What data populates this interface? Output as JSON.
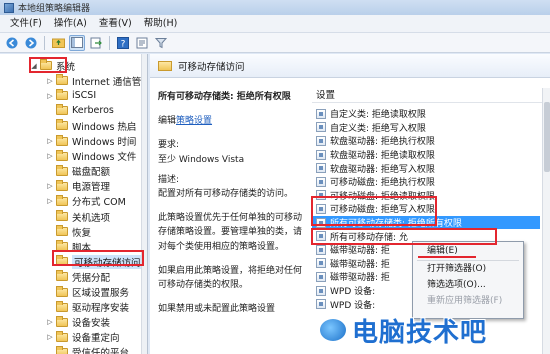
{
  "window": {
    "title": "本地组策略编辑器"
  },
  "menu": [
    "文件(F)",
    "操作(A)",
    "查看(V)",
    "帮助(H)"
  ],
  "toolbar": [
    "back-icon",
    "forward-icon",
    "folder-up-icon",
    "show-hide-tree-icon",
    "export-icon",
    "help-icon",
    "properties-icon",
    "filter-icon"
  ],
  "tree": {
    "items": [
      {
        "label": "系统",
        "expander": "◢",
        "selected": false
      },
      {
        "label": "Internet 通信管",
        "expander": "▷"
      },
      {
        "label": "iSCSI",
        "expander": "▷"
      },
      {
        "label": "Kerberos",
        "expander": ""
      },
      {
        "label": "Windows 热启",
        "expander": ""
      },
      {
        "label": "Windows 时间",
        "expander": "▷"
      },
      {
        "label": "Windows 文件",
        "expander": "▷"
      },
      {
        "label": "磁盘配额",
        "expander": ""
      },
      {
        "label": "电源管理",
        "expander": "▷"
      },
      {
        "label": "分布式 COM",
        "expander": "▷"
      },
      {
        "label": "关机选项",
        "expander": ""
      },
      {
        "label": "恢复",
        "expander": ""
      },
      {
        "label": "脚本",
        "expander": ""
      },
      {
        "label": "可移动存储访问",
        "expander": "",
        "selected": true
      },
      {
        "label": "凭据分配",
        "expander": ""
      },
      {
        "label": "区域设置服务",
        "expander": ""
      },
      {
        "label": "驱动程序安装",
        "expander": ""
      },
      {
        "label": "设备安装",
        "expander": "▷"
      },
      {
        "label": "设备重定向",
        "expander": "▷"
      },
      {
        "label": "受信任的平台",
        "expander": ""
      }
    ]
  },
  "pane": {
    "header": "可移动存储访问",
    "setting_title": "所有可移动存储类: 拒绝所有权限",
    "edit_prefix": "编辑",
    "edit_link": "策略设置",
    "req_label": "要求:",
    "req_value": "至少 Windows Vista",
    "desc_label": "描述:",
    "desc_value": "配置对所有可移动存储类的访问。",
    "para1": "此策略设置优先于任何单独的可移动存储策略设置。要管理单独的类，请对每个类使用相应的策略设置。",
    "para2": "如果启用此策略设置，将拒绝对任何可移动存储类的权限。",
    "para3": "如果禁用或未配置此策略设置"
  },
  "list": {
    "column": "设置",
    "rows": [
      "自定义类: 拒绝读取权限",
      "自定义类: 拒绝写入权限",
      "软盘驱动器: 拒绝执行权限",
      "软盘驱动器: 拒绝读取权限",
      "软盘驱动器: 拒绝写入权限",
      "可移动磁盘: 拒绝执行权限",
      "可移动磁盘: 拒绝读取权限",
      "可移动磁盘: 拒绝写入权限",
      "所有可移动存储类: 拒绝所有权限",
      "所有可移动存储: 允",
      "磁带驱动器: 拒",
      "磁带驱动器: 拒",
      "磁带驱动器: 拒",
      "WPD 设备:",
      "WPD 设备:"
    ],
    "selected_index": 8
  },
  "context_menu": {
    "items": [
      {
        "label": "编辑(E)",
        "disabled": false
      },
      {
        "label": "打开筛选器(O)",
        "disabled": false
      },
      {
        "label": "筛选选项(O)...",
        "disabled": false
      },
      {
        "label": "重新应用筛选器(F)",
        "disabled": true
      }
    ]
  },
  "watermark": {
    "text": "电脑技术吧"
  },
  "colors": {
    "annotation_red": "#e3262f",
    "selection_blue": "#3399ff"
  }
}
